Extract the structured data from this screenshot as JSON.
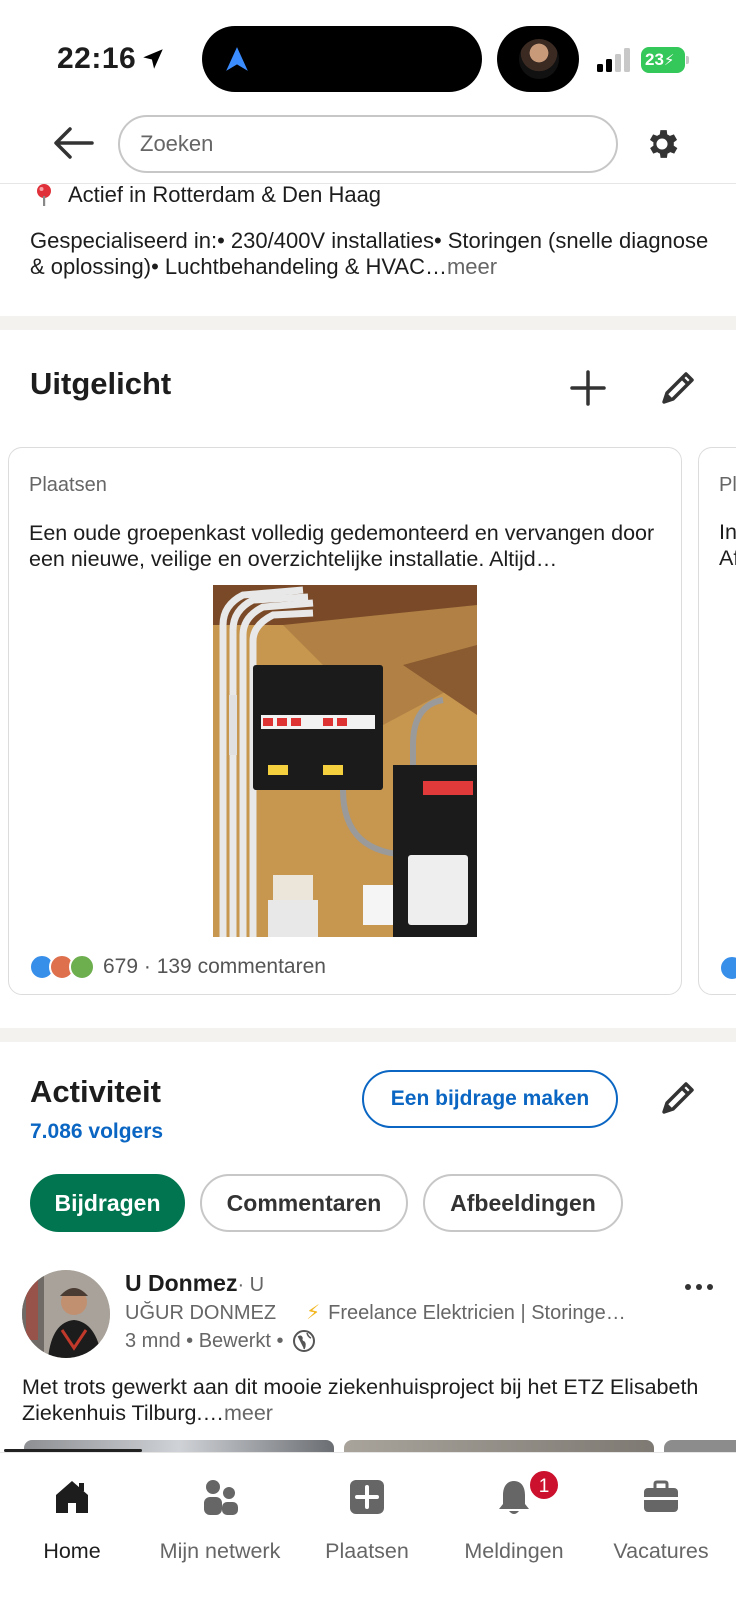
{
  "status_bar": {
    "time": "22:16",
    "battery": "23"
  },
  "header": {
    "search_placeholder": "Zoeken"
  },
  "about": {
    "location": "Actief in Rotterdam & Den Haag",
    "text": "Gespecialiseerd in:• 230/400V installaties• Storingen (snelle diagnose & oplossing)• Luchtbehandeling & HVAC…",
    "more": "meer"
  },
  "featured": {
    "title": "Uitgelicht",
    "card": {
      "label": "Plaatsen",
      "text": "Een oude groepenkast volledig gedemonteerd en vervangen door een nieuwe, veilige en overzichtelijke installatie. Altijd…",
      "reactions": "679 · 139 commentaren"
    },
    "card2": {
      "label": "Pl",
      "line1": "In",
      "line2": "Af"
    }
  },
  "activity": {
    "title": "Activiteit",
    "followers": "7.086 volgers",
    "post_button": "Een bijdrage maken",
    "tabs": [
      "Bijdragen",
      "Commentaren",
      "Afbeeldingen"
    ],
    "post": {
      "name": "U Donmez",
      "degree": "· U",
      "company": "UĞUR DONMEZ",
      "headline": "Freelance Elektricien | Storinge…",
      "time": "3 mnd • Bewerkt •",
      "text": "Met trots gewerkt aan dit mooie ziekenhuisproject bij het ETZ Elisabeth Ziekenhuis Tilburg.…",
      "more": "meer"
    }
  },
  "bottom_nav": {
    "items": [
      "Home",
      "Mijn netwerk",
      "Plaatsen",
      "Meldingen",
      "Vacatures"
    ],
    "notification_count": "1"
  },
  "colors": {
    "brand_blue": "#0a66c2",
    "active_green": "#01754f",
    "badge_red": "#cb112d"
  }
}
